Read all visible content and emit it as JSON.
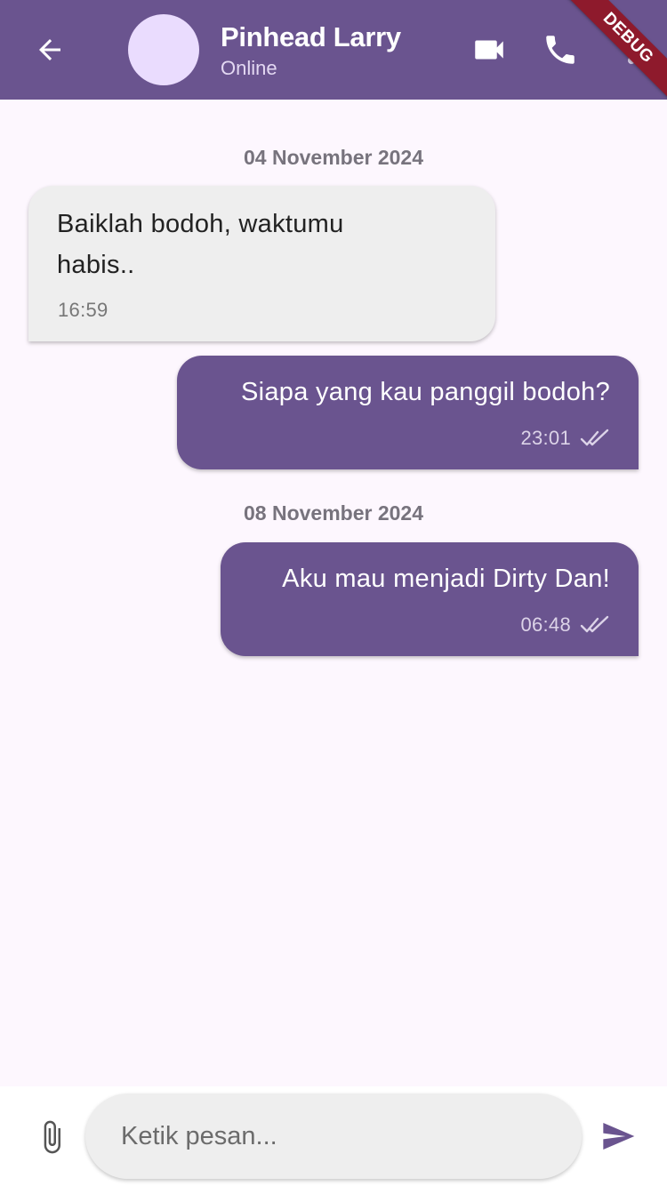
{
  "header": {
    "contact_name": "Pinhead Larry",
    "contact_status": "Online",
    "icons": {
      "back": "arrow-back-icon",
      "video": "videocam-icon",
      "call": "phone-icon"
    }
  },
  "debug_banner": "DEBUG",
  "conversation": {
    "groups": [
      {
        "date": "04 November 2024",
        "messages": [
          {
            "direction": "incoming",
            "text": "Baiklah bodoh, waktumu habis..",
            "time": "16:59"
          },
          {
            "direction": "outgoing",
            "text": "Siapa yang kau panggil bodoh?",
            "time": "23:01",
            "status": "read"
          }
        ]
      },
      {
        "date": "08 November 2024",
        "messages": [
          {
            "direction": "outgoing",
            "text": "Aku mau menjadi Dirty Dan!",
            "time": "06:48",
            "status": "read"
          }
        ]
      }
    ]
  },
  "composer": {
    "placeholder": "Ketik pesan...",
    "value": "",
    "icons": {
      "attach": "paperclip-icon",
      "send": "send-icon"
    }
  },
  "colors": {
    "primary": "#6a548f",
    "avatar": "#eadcfe",
    "background": "#fdf7fe",
    "incoming_bubble": "#eeeeee",
    "debug_ribbon": "#8e1a2c"
  }
}
